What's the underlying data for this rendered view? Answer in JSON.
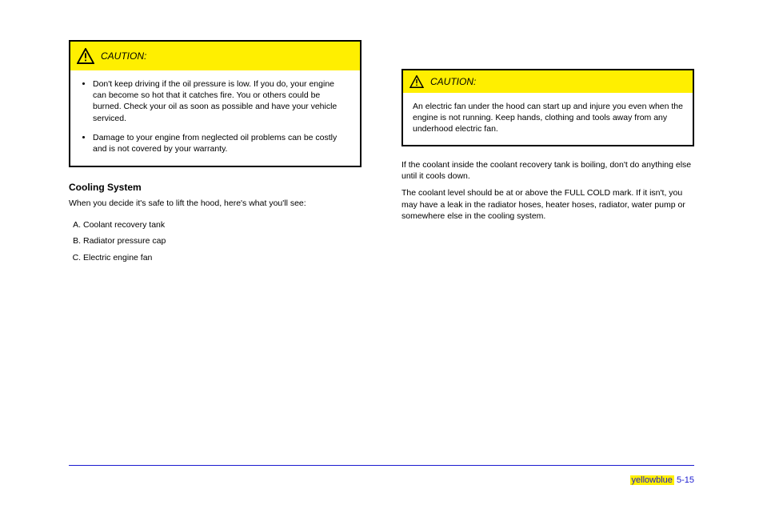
{
  "caution_left": {
    "label": "CAUTION:",
    "bullets": [
      "Don't keep driving if the oil pressure is low. If you do, your engine can become so hot that it catches fire. You or others could be burned. Check your oil as soon as possible and have your vehicle serviced.",
      "Damage to your engine from neglected oil problems can be costly and is not covered by your warranty."
    ]
  },
  "section1": {
    "title": "Cooling System",
    "intro": "When you decide it's safe to lift the hood, here's what you'll see:"
  },
  "figure_labels": {
    "items": [
      "Coolant recovery tank",
      "Radiator pressure cap",
      "Electric engine fan"
    ]
  },
  "caution_right": {
    "label": "CAUTION:",
    "text": "An electric fan under the hood can start up and injure you even when the engine is not running. Keep hands, clothing and tools away from any underhood electric fan."
  },
  "section2": {
    "p1": "If the coolant inside the coolant recovery tank is boiling, don't do anything else until it cools down.",
    "p2": "The coolant level should be at or above the FULL COLD mark. If it isn't, you may have a leak in the radiator hoses, heater hoses, radiator, water pump or somewhere else in the cooling system."
  },
  "page": {
    "prefix": "yellowblue",
    "num": "5-15"
  }
}
